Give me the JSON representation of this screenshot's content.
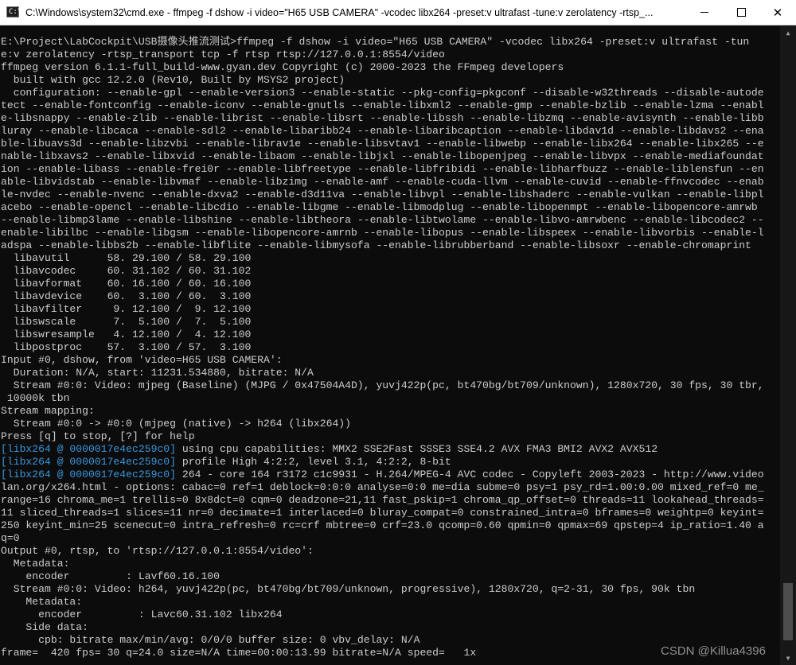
{
  "window": {
    "title": "C:\\Windows\\system32\\cmd.exe - ffmpeg  -f dshow -i video=\"H65 USB CAMERA\" -vcodec libx264 -preset:v ultrafast -tune:v zerolatency -rtsp_...",
    "app_icon_text": "C:\\",
    "icons": {
      "app": "cmd-icon",
      "minimize": "minimize-icon",
      "maximize": "maximize-icon",
      "close": "close-icon"
    },
    "close_glyph": "✕"
  },
  "colors": {
    "background": "#0c0c0c",
    "text": "#cccccc",
    "libx264_tag": "#3a96dd"
  },
  "console": {
    "lines": [
      {
        "text": "E:\\Project\\LabCockpit\\USB摄像头推流测试>ffmpeg -f dshow -i video=\"H65 USB CAMERA\" -vcodec libx264 -preset:v ultrafast -tun"
      },
      {
        "text": "e:v zerolatency -rtsp_transport tcp -f rtsp rtsp://127.0.0.1:8554/video"
      },
      {
        "text": "ffmpeg version 6.1.1-full_build-www.gyan.dev Copyright (c) 2000-2023 the FFmpeg developers"
      },
      {
        "text": "  built with gcc 12.2.0 (Rev10, Built by MSYS2 project)"
      },
      {
        "text": "  configuration: --enable-gpl --enable-version3 --enable-static --pkg-config=pkgconf --disable-w32threads --disable-autode"
      },
      {
        "text": "tect --enable-fontconfig --enable-iconv --enable-gnutls --enable-libxml2 --enable-gmp --enable-bzlib --enable-lzma --enabl"
      },
      {
        "text": "e-libsnappy --enable-zlib --enable-librist --enable-libsrt --enable-libssh --enable-libzmq --enable-avisynth --enable-libb"
      },
      {
        "text": "luray --enable-libcaca --enable-sdl2 --enable-libaribb24 --enable-libaribcaption --enable-libdav1d --enable-libdavs2 --ena"
      },
      {
        "text": "ble-libuavs3d --enable-libzvbi --enable-librav1e --enable-libsvtav1 --enable-libwebp --enable-libx264 --enable-libx265 --e"
      },
      {
        "text": "nable-libxavs2 --enable-libxvid --enable-libaom --enable-libjxl --enable-libopenjpeg --enable-libvpx --enable-mediafoundat"
      },
      {
        "text": "ion --enable-libass --enable-frei0r --enable-libfreetype --enable-libfribidi --enable-libharfbuzz --enable-liblensfun --en"
      },
      {
        "text": "able-libvidstab --enable-libvmaf --enable-libzimg --enable-amf --enable-cuda-llvm --enable-cuvid --enable-ffnvcodec --enab"
      },
      {
        "text": "le-nvdec --enable-nvenc --enable-dxva2 --enable-d3d11va --enable-libvpl --enable-libshaderc --enable-vulkan --enable-libpl"
      },
      {
        "text": "acebo --enable-opencl --enable-libcdio --enable-libgme --enable-libmodplug --enable-libopenmpt --enable-libopencore-amrwb "
      },
      {
        "text": "--enable-libmp3lame --enable-libshine --enable-libtheora --enable-libtwolame --enable-libvo-amrwbenc --enable-libcodec2 --"
      },
      {
        "text": "enable-libilbc --enable-libgsm --enable-libopencore-amrnb --enable-libopus --enable-libspeex --enable-libvorbis --enable-l"
      },
      {
        "text": "adspa --enable-libbs2b --enable-libflite --enable-libmysofa --enable-librubberband --enable-libsoxr --enable-chromaprint"
      },
      {
        "text": "  libavutil      58. 29.100 / 58. 29.100"
      },
      {
        "text": "  libavcodec     60. 31.102 / 60. 31.102"
      },
      {
        "text": "  libavformat    60. 16.100 / 60. 16.100"
      },
      {
        "text": "  libavdevice    60.  3.100 / 60.  3.100"
      },
      {
        "text": "  libavfilter     9. 12.100 /  9. 12.100"
      },
      {
        "text": "  libswscale      7.  5.100 /  7.  5.100"
      },
      {
        "text": "  libswresample   4. 12.100 /  4. 12.100"
      },
      {
        "text": "  libpostproc    57.  3.100 / 57.  3.100"
      },
      {
        "text": "Input #0, dshow, from 'video=H65 USB CAMERA':"
      },
      {
        "text": "  Duration: N/A, start: 11231.534880, bitrate: N/A"
      },
      {
        "text": "  Stream #0:0: Video: mjpeg (Baseline) (MJPG / 0x47504A4D), yuvj422p(pc, bt470bg/bt709/unknown), 1280x720, 30 fps, 30 tbr,"
      },
      {
        "text": " 10000k tbn"
      },
      {
        "text": "Stream mapping:"
      },
      {
        "text": "  Stream #0:0 -> #0:0 (mjpeg (native) -> h264 (libx264))"
      },
      {
        "text": "Press [q] to stop, [?] for help"
      },
      {
        "tag": "[libx264 @ 0000017e4ec259c0]",
        "text": " using cpu capabilities: MMX2 SSE2Fast SSSE3 SSE4.2 AVX FMA3 BMI2 AVX2 AVX512"
      },
      {
        "tag": "[libx264 @ 0000017e4ec259c0]",
        "text": " profile High 4:2:2, level 3.1, 4:2:2, 8-bit"
      },
      {
        "tag": "[libx264 @ 0000017e4ec259c0]",
        "text": " 264 - core 164 r3172 c1c9931 - H.264/MPEG-4 AVC codec - Copyleft 2003-2023 - http://www.video"
      },
      {
        "text": "lan.org/x264.html - options: cabac=0 ref=1 deblock=0:0:0 analyse=0:0 me=dia subme=0 psy=1 psy_rd=1.00:0.00 mixed_ref=0 me_"
      },
      {
        "text": "range=16 chroma_me=1 trellis=0 8x8dct=0 cqm=0 deadzone=21,11 fast_pskip=1 chroma_qp_offset=0 threads=11 lookahead_threads="
      },
      {
        "text": "11 sliced_threads=1 slices=11 nr=0 decimate=1 interlaced=0 bluray_compat=0 constrained_intra=0 bframes=0 weightp=0 keyint="
      },
      {
        "text": "250 keyint_min=25 scenecut=0 intra_refresh=0 rc=crf mbtree=0 crf=23.0 qcomp=0.60 qpmin=0 qpmax=69 qpstep=4 ip_ratio=1.40 a"
      },
      {
        "text": "q=0"
      },
      {
        "text": "Output #0, rtsp, to 'rtsp://127.0.0.1:8554/video':"
      },
      {
        "text": "  Metadata:"
      },
      {
        "text": "    encoder         : Lavf60.16.100"
      },
      {
        "text": "  Stream #0:0: Video: h264, yuvj422p(pc, bt470bg/bt709/unknown, progressive), 1280x720, q=2-31, 30 fps, 90k tbn"
      },
      {
        "text": "    Metadata:"
      },
      {
        "text": "      encoder         : Lavc60.31.102 libx264"
      },
      {
        "text": "    Side data:"
      },
      {
        "text": "      cpb: bitrate max/min/avg: 0/0/0 buffer size: 0 vbv_delay: N/A"
      },
      {
        "text": "frame=  420 fps= 30 q=24.0 size=N/A time=00:00:13.99 bitrate=N/A speed=   1x"
      }
    ]
  },
  "scrollbar": {
    "icons": {
      "up": "scroll-up-arrow-icon",
      "down": "scroll-down-arrow-icon"
    }
  },
  "watermark": "CSDN @Killua4396"
}
